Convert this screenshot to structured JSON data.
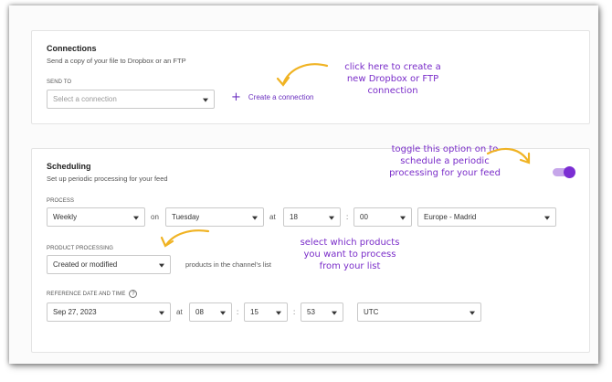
{
  "connections": {
    "title": "Connections",
    "subtitle": "Send a copy of your file to Dropbox or an FTP",
    "send_to_label": "SEND TO",
    "select_placeholder": "Select a connection",
    "create_link": "Create a connection",
    "annotation": [
      "click here to create a",
      "new Dropbox or FTP",
      "connection"
    ]
  },
  "scheduling": {
    "title": "Scheduling",
    "subtitle": "Set up periodic processing for your feed",
    "toggle_on": true,
    "toggle_annotation": [
      "toggle this option on to",
      "schedule a periodic",
      "processing for your feed"
    ],
    "process_label": "PROCESS",
    "frequency": "Weekly",
    "on_label": "on",
    "day": "Tuesday",
    "at_label": "at",
    "hour": "18",
    "colon": ":",
    "minute": "00",
    "timezone": "Europe - Madrid",
    "product_processing_label": "PRODUCT PROCESSING",
    "product_processing_value": "Created or modified",
    "product_processing_suffix": "products in the channel's list",
    "product_annotation": [
      "select which products",
      "you want to process",
      "from your list"
    ],
    "reference_label": "REFERENCE DATE AND TIME",
    "ref_date": "Sep 27, 2023",
    "ref_at_label": "at",
    "ref_hour": "08",
    "ref_minute": "15",
    "ref_second": "53",
    "ref_timezone": "UTC"
  },
  "colors": {
    "accent": "#7b2ed3",
    "annotation_text": "#7a2dc9",
    "annotation_arrow": "#f0b323"
  },
  "icons": [
    "plus-icon",
    "chevron-down-icon",
    "info-icon",
    "curved-arrow-icon"
  ]
}
